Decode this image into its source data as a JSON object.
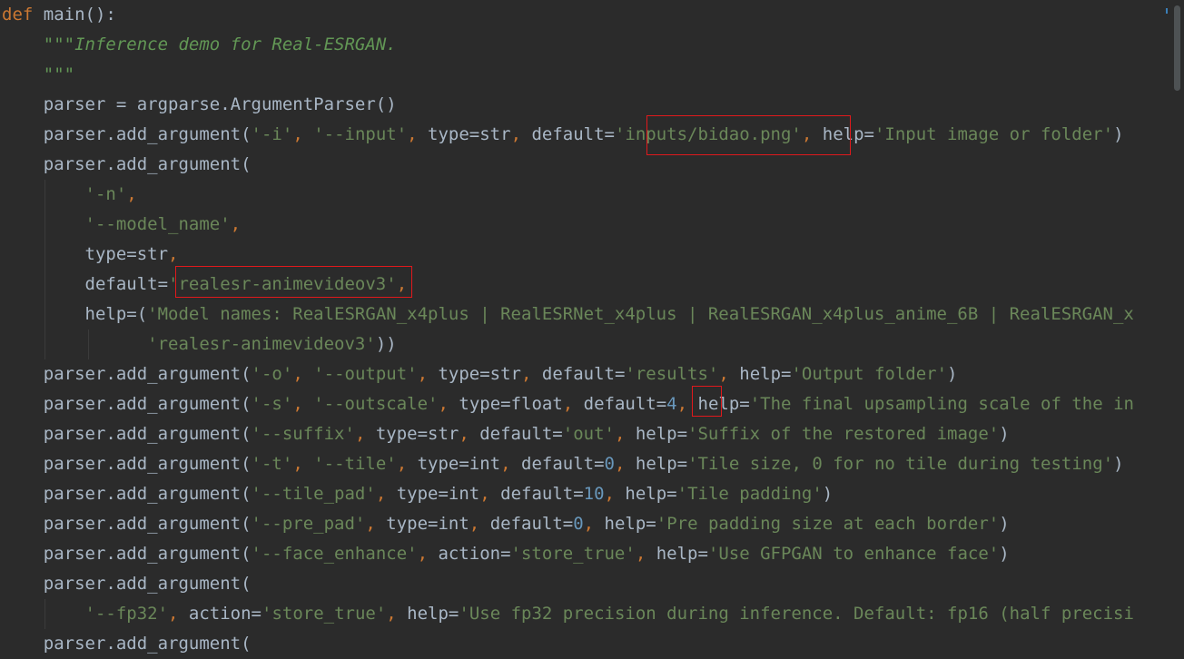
{
  "lines": [
    [
      {
        "t": "def",
        "c": "kw"
      },
      {
        "t": " main():",
        "c": "plain"
      }
    ],
    [
      {
        "t": "    ",
        "c": "plain"
      },
      {
        "t": "\"\"\"Inference demo for Real-ESRGAN.",
        "c": "doc"
      }
    ],
    [
      {
        "t": "    ",
        "c": "plain"
      },
      {
        "t": "\"\"\"",
        "c": "doc"
      }
    ],
    [
      {
        "t": "    parser = argparse.ArgumentParser()",
        "c": "plain"
      }
    ],
    [
      {
        "t": "    parser.add_argument(",
        "c": "plain"
      },
      {
        "t": "'-i'",
        "c": "str"
      },
      {
        "t": ", ",
        "c": "kw"
      },
      {
        "t": "'--input'",
        "c": "str"
      },
      {
        "t": ", ",
        "c": "kw"
      },
      {
        "t": "type=str",
        "c": "plain"
      },
      {
        "t": ", ",
        "c": "kw"
      },
      {
        "t": "default=",
        "c": "plain"
      },
      {
        "t": "'inputs/bidao.png'",
        "c": "str"
      },
      {
        "t": ", ",
        "c": "kw"
      },
      {
        "t": "help=",
        "c": "plain"
      },
      {
        "t": "'Input image or folder'",
        "c": "str"
      },
      {
        "t": ")",
        "c": "plain"
      }
    ],
    [
      {
        "t": "    parser.add_argument(",
        "c": "plain"
      }
    ],
    [
      {
        "t": "        ",
        "c": "plain"
      },
      {
        "t": "'-n'",
        "c": "str"
      },
      {
        "t": ",",
        "c": "kw"
      }
    ],
    [
      {
        "t": "        ",
        "c": "plain"
      },
      {
        "t": "'--model_name'",
        "c": "str"
      },
      {
        "t": ",",
        "c": "kw"
      }
    ],
    [
      {
        "t": "        type=str",
        "c": "plain"
      },
      {
        "t": ",",
        "c": "kw"
      }
    ],
    [
      {
        "t": "        default=",
        "c": "plain"
      },
      {
        "t": "'realesr-animevideov3'",
        "c": "str"
      },
      {
        "t": ",",
        "c": "kw"
      }
    ],
    [
      {
        "t": "        help=(",
        "c": "plain"
      },
      {
        "t": "'Model names: RealESRGAN_x4plus | RealESRNet_x4plus | RealESRGAN_x4plus_anime_6B | RealESRGAN_x",
        "c": "str"
      }
    ],
    [
      {
        "t": "              ",
        "c": "plain"
      },
      {
        "t": "'realesr-animevideov3'",
        "c": "str"
      },
      {
        "t": "))",
        "c": "plain"
      }
    ],
    [
      {
        "t": "    parser.add_argument(",
        "c": "plain"
      },
      {
        "t": "'-o'",
        "c": "str"
      },
      {
        "t": ", ",
        "c": "kw"
      },
      {
        "t": "'--output'",
        "c": "str"
      },
      {
        "t": ", ",
        "c": "kw"
      },
      {
        "t": "type=str",
        "c": "plain"
      },
      {
        "t": ", ",
        "c": "kw"
      },
      {
        "t": "default=",
        "c": "plain"
      },
      {
        "t": "'results'",
        "c": "str"
      },
      {
        "t": ", ",
        "c": "kw"
      },
      {
        "t": "help=",
        "c": "plain"
      },
      {
        "t": "'Output folder'",
        "c": "str"
      },
      {
        "t": ")",
        "c": "plain"
      }
    ],
    [
      {
        "t": "    parser.add_argument(",
        "c": "plain"
      },
      {
        "t": "'-s'",
        "c": "str"
      },
      {
        "t": ", ",
        "c": "kw"
      },
      {
        "t": "'--outscale'",
        "c": "str"
      },
      {
        "t": ", ",
        "c": "kw"
      },
      {
        "t": "type=float",
        "c": "plain"
      },
      {
        "t": ", ",
        "c": "kw"
      },
      {
        "t": "default=",
        "c": "plain"
      },
      {
        "t": "4",
        "c": "num"
      },
      {
        "t": ", ",
        "c": "kw"
      },
      {
        "t": "help=",
        "c": "plain"
      },
      {
        "t": "'The final upsampling scale of the in",
        "c": "str"
      }
    ],
    [
      {
        "t": "    parser.add_argument(",
        "c": "plain"
      },
      {
        "t": "'--suffix'",
        "c": "str"
      },
      {
        "t": ", ",
        "c": "kw"
      },
      {
        "t": "type=str",
        "c": "plain"
      },
      {
        "t": ", ",
        "c": "kw"
      },
      {
        "t": "default=",
        "c": "plain"
      },
      {
        "t": "'out'",
        "c": "str"
      },
      {
        "t": ", ",
        "c": "kw"
      },
      {
        "t": "help=",
        "c": "plain"
      },
      {
        "t": "'Suffix of the restored image'",
        "c": "str"
      },
      {
        "t": ")",
        "c": "plain"
      }
    ],
    [
      {
        "t": "    parser.add_argument(",
        "c": "plain"
      },
      {
        "t": "'-t'",
        "c": "str"
      },
      {
        "t": ", ",
        "c": "kw"
      },
      {
        "t": "'--tile'",
        "c": "str"
      },
      {
        "t": ", ",
        "c": "kw"
      },
      {
        "t": "type=int",
        "c": "plain"
      },
      {
        "t": ", ",
        "c": "kw"
      },
      {
        "t": "default=",
        "c": "plain"
      },
      {
        "t": "0",
        "c": "num"
      },
      {
        "t": ", ",
        "c": "kw"
      },
      {
        "t": "help=",
        "c": "plain"
      },
      {
        "t": "'Tile size, 0 for no tile during testing'",
        "c": "str"
      },
      {
        "t": ")",
        "c": "plain"
      }
    ],
    [
      {
        "t": "    parser.add_argument(",
        "c": "plain"
      },
      {
        "t": "'--tile_pad'",
        "c": "str"
      },
      {
        "t": ", ",
        "c": "kw"
      },
      {
        "t": "type=int",
        "c": "plain"
      },
      {
        "t": ", ",
        "c": "kw"
      },
      {
        "t": "default=",
        "c": "plain"
      },
      {
        "t": "10",
        "c": "num"
      },
      {
        "t": ", ",
        "c": "kw"
      },
      {
        "t": "help=",
        "c": "plain"
      },
      {
        "t": "'Tile padding'",
        "c": "str"
      },
      {
        "t": ")",
        "c": "plain"
      }
    ],
    [
      {
        "t": "    parser.add_argument(",
        "c": "plain"
      },
      {
        "t": "'--pre_pad'",
        "c": "str"
      },
      {
        "t": ", ",
        "c": "kw"
      },
      {
        "t": "type=int",
        "c": "plain"
      },
      {
        "t": ", ",
        "c": "kw"
      },
      {
        "t": "default=",
        "c": "plain"
      },
      {
        "t": "0",
        "c": "num"
      },
      {
        "t": ", ",
        "c": "kw"
      },
      {
        "t": "help=",
        "c": "plain"
      },
      {
        "t": "'Pre padding size at each border'",
        "c": "str"
      },
      {
        "t": ")",
        "c": "plain"
      }
    ],
    [
      {
        "t": "    parser.add_argument(",
        "c": "plain"
      },
      {
        "t": "'--face_enhance'",
        "c": "str"
      },
      {
        "t": ", ",
        "c": "kw"
      },
      {
        "t": "action=",
        "c": "plain"
      },
      {
        "t": "'store_true'",
        "c": "str"
      },
      {
        "t": ", ",
        "c": "kw"
      },
      {
        "t": "help=",
        "c": "plain"
      },
      {
        "t": "'Use GFPGAN to enhance face'",
        "c": "str"
      },
      {
        "t": ")",
        "c": "plain"
      }
    ],
    [
      {
        "t": "    parser.add_argument(",
        "c": "plain"
      }
    ],
    [
      {
        "t": "        ",
        "c": "plain"
      },
      {
        "t": "'--fp32'",
        "c": "str"
      },
      {
        "t": ", ",
        "c": "kw"
      },
      {
        "t": "action=",
        "c": "plain"
      },
      {
        "t": "'store_true'",
        "c": "str"
      },
      {
        "t": ", ",
        "c": "kw"
      },
      {
        "t": "help=",
        "c": "plain"
      },
      {
        "t": "'Use fp32 precision during inference. Default: fp16 (half precisi",
        "c": "str"
      }
    ],
    [
      {
        "t": "    parser.add_argument(",
        "c": "plain"
      }
    ]
  ],
  "colors": {
    "background": "#2b2b2b",
    "keyword": "#cc7832",
    "docstring": "#629755",
    "string": "#6a8759",
    "number": "#6897bb",
    "default_text": "#a9b7c6",
    "highlight_box": "#e0191c"
  }
}
